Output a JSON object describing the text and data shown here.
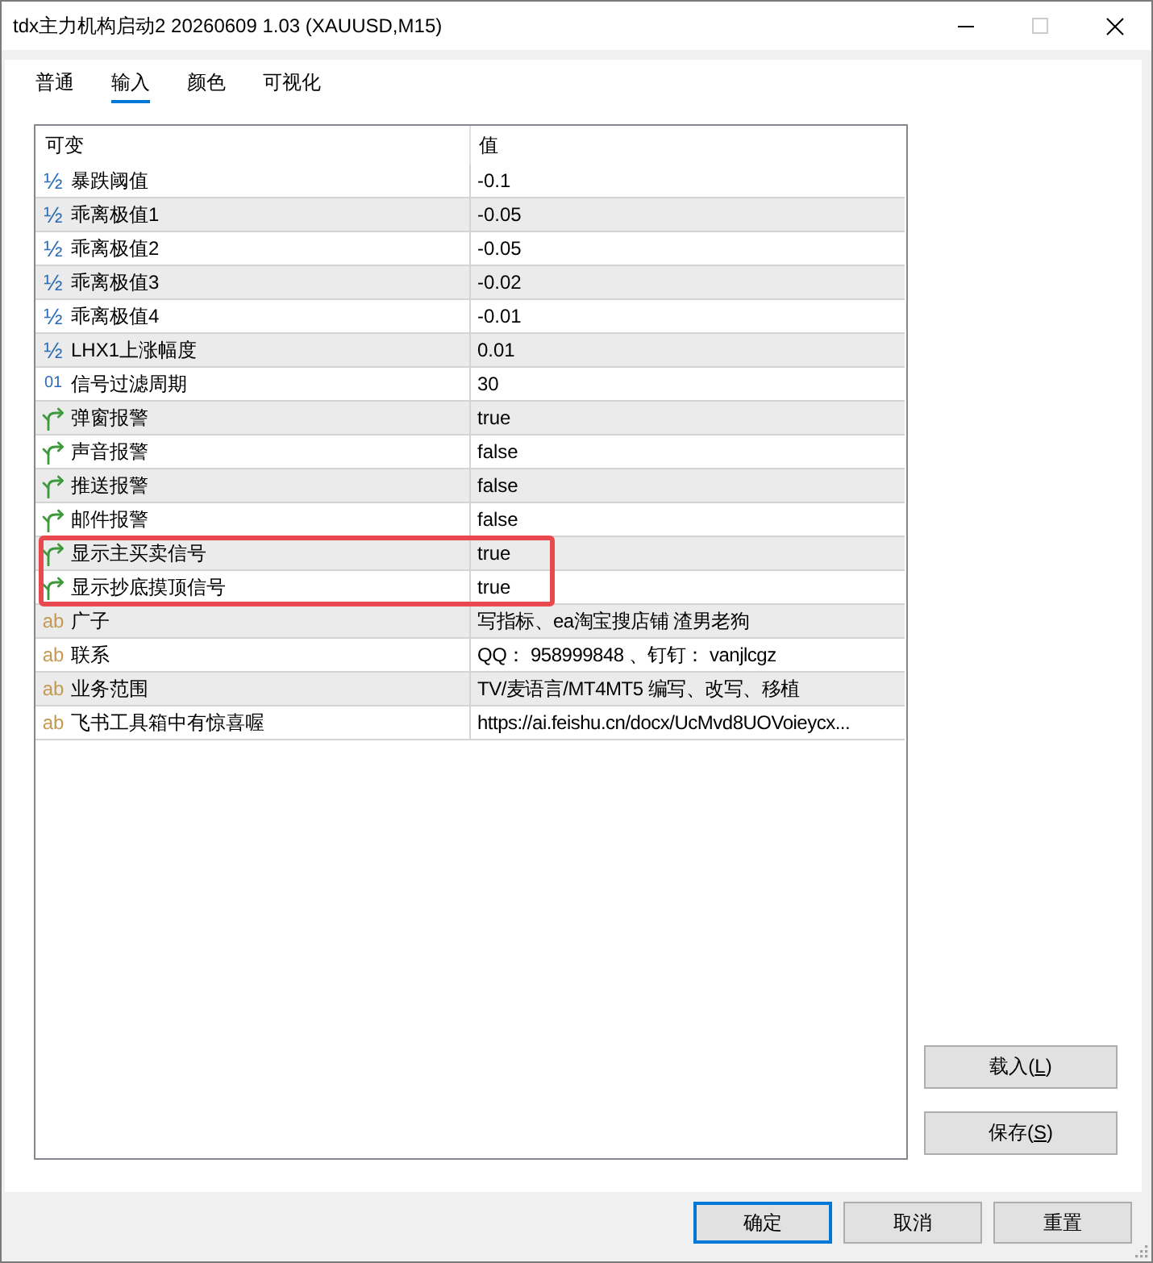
{
  "window": {
    "title": "tdx主力机构启动2 20260609 1.03 (XAUUSD,M15)",
    "maximize_disabled": true
  },
  "tabs": [
    {
      "label": "普通",
      "selected": false
    },
    {
      "label": "输入",
      "selected": true
    },
    {
      "label": "颜色",
      "selected": false
    },
    {
      "label": "可视化",
      "selected": false
    }
  ],
  "table": {
    "columns": [
      "可变",
      "值"
    ],
    "rows": [
      {
        "kind": "double",
        "mark": "½",
        "name": "暴跌阈值",
        "value": "-0.1",
        "highlighted": false
      },
      {
        "kind": "double",
        "mark": "½",
        "name": "乖离极值1",
        "value": "-0.05",
        "highlighted": false
      },
      {
        "kind": "double",
        "mark": "½",
        "name": "乖离极值2",
        "value": "-0.05",
        "highlighted": false
      },
      {
        "kind": "double",
        "mark": "½",
        "name": "乖离极值3",
        "value": "-0.02",
        "highlighted": false
      },
      {
        "kind": "double",
        "mark": "½",
        "name": "乖离极值4",
        "value": "-0.01",
        "highlighted": false
      },
      {
        "kind": "double",
        "mark": "½",
        "name": "LHX1上涨幅度",
        "value": "0.01",
        "highlighted": false
      },
      {
        "kind": "int",
        "mark": "01",
        "name": "信号过滤周期",
        "value": "30",
        "highlighted": false
      },
      {
        "kind": "bool",
        "name": "弹窗报警",
        "value": "true",
        "highlighted": false
      },
      {
        "kind": "bool",
        "name": "声音报警",
        "value": "false",
        "highlighted": false
      },
      {
        "kind": "bool",
        "name": "推送报警",
        "value": "false",
        "highlighted": false
      },
      {
        "kind": "bool",
        "name": "邮件报警",
        "value": "false",
        "highlighted": false
      },
      {
        "kind": "bool",
        "name": "显示主买卖信号",
        "value": "true",
        "highlighted": true
      },
      {
        "kind": "bool",
        "name": "显示抄底摸顶信号",
        "value": "true",
        "highlighted": true
      },
      {
        "kind": "string",
        "mark": "ab",
        "name": "广子",
        "value": "写指标、ea淘宝搜店铺 渣男老狗",
        "highlighted": false
      },
      {
        "kind": "string",
        "mark": "ab",
        "name": "联系",
        "value": "QQ： 958999848 、钉钉： vanjlcgz",
        "highlighted": false
      },
      {
        "kind": "string",
        "mark": "ab",
        "name": "业务范围",
        "value": "TV/麦语言/MT4MT5 编写、改写、移植",
        "highlighted": false
      },
      {
        "kind": "string",
        "mark": "ab",
        "name": "飞书工具箱中有惊喜喔",
        "value": "https://ai.feishu.cn/docx/UcMvd8UOVoieycx...",
        "highlighted": false
      }
    ]
  },
  "side_buttons": [
    {
      "label_before": "载入(",
      "mnemonic": "L",
      "label_after": ")"
    },
    {
      "label_before": "保存(",
      "mnemonic": "S",
      "label_after": ")"
    }
  ],
  "footer_buttons": [
    {
      "label": "确定",
      "default": true
    },
    {
      "label": "取消",
      "default": false
    },
    {
      "label": "重置",
      "default": false
    }
  ]
}
